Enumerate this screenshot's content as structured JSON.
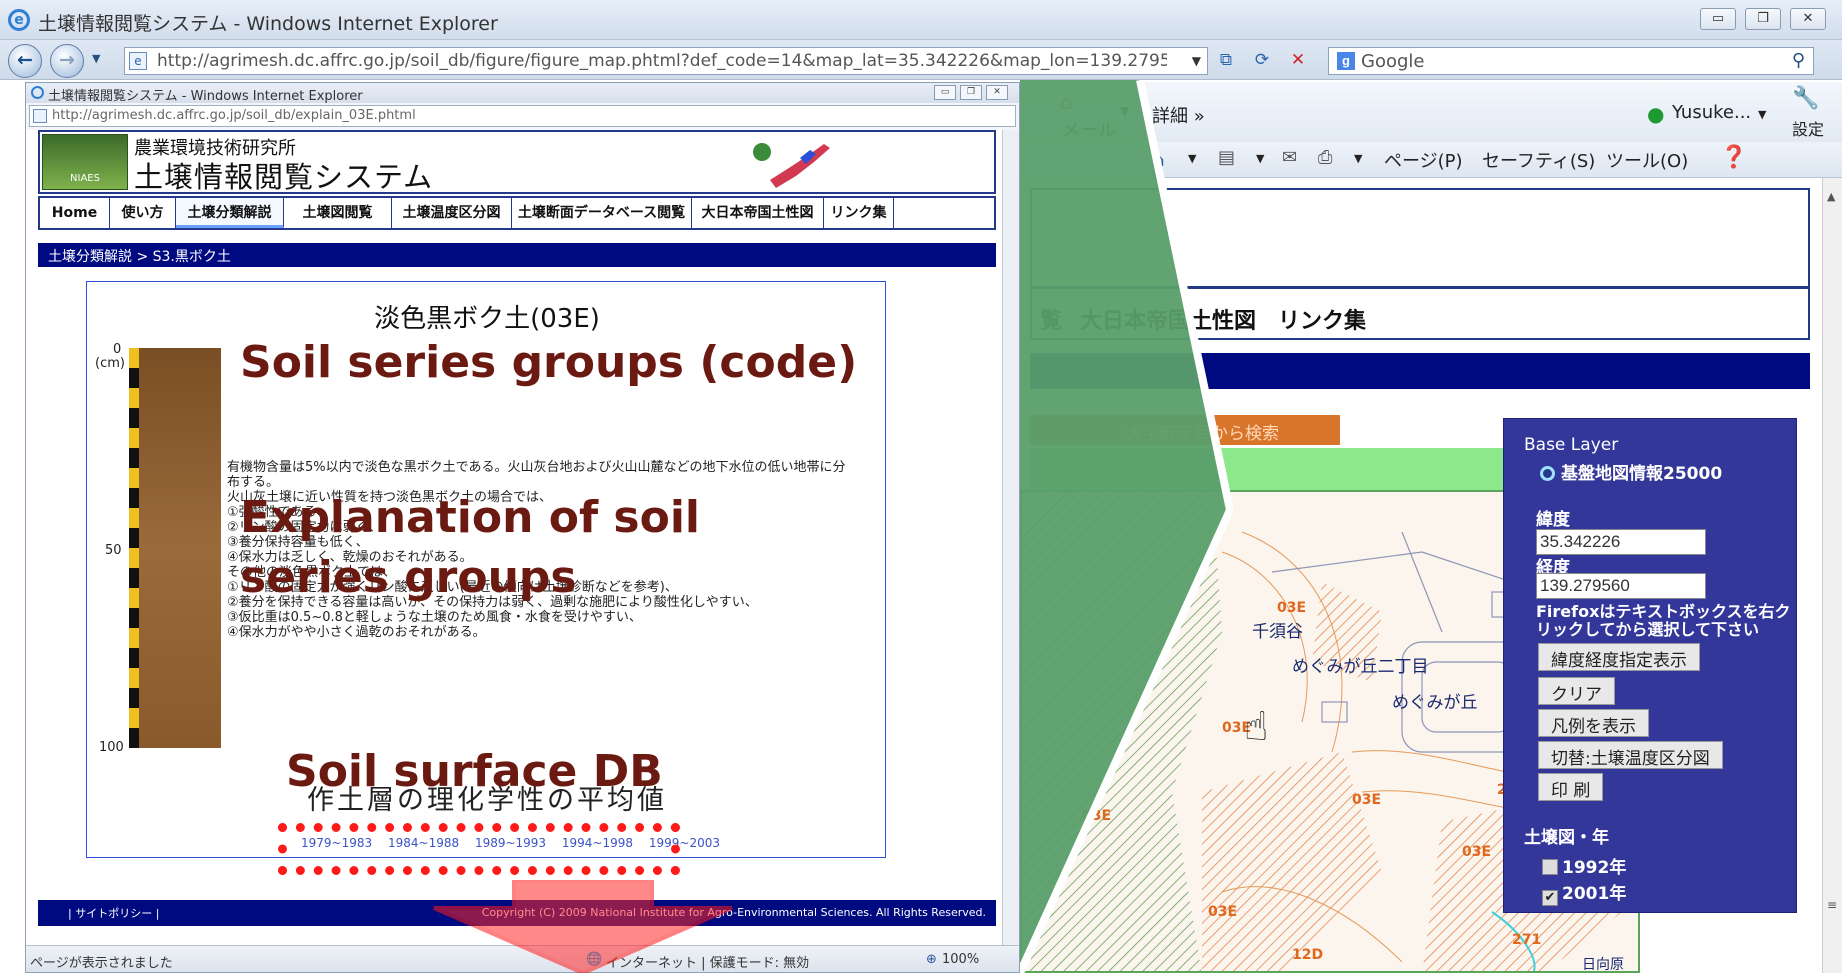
{
  "outer_window": {
    "title": "土壌情報閲覧システム - Windows Internet Explorer",
    "address": "http://agrimesh.dc.affrc.go.jp/soil_db/figure/figure_map.phtml?def_code=14&map_lat=35.342226&map_lon=139.2795€",
    "search_engine": "Google",
    "minimize_glyph": "▭",
    "restore_glyph": "❐",
    "close_glyph": "✕"
  },
  "outer_commands": {
    "mail": "メール",
    "detail": "詳細 »",
    "user": "Yusuke...",
    "settings": "設定",
    "page": "ページ(P)",
    "safety": "セーフティ(S)",
    "tools": "ツール(O)"
  },
  "outer_page": {
    "nav_partial": "覧",
    "nav_imperial": "大日本帝国土性図",
    "nav_links": "リンク集",
    "orange_tab": "大字町丁目から検索",
    "map_labels": [
      "千須谷",
      "めぐみが丘二丁目",
      "めぐみが丘"
    ],
    "map_codes": [
      "03E",
      "03E",
      "03E",
      "03E",
      "03E",
      "03E",
      "12D",
      "271",
      "271"
    ],
    "map_bottom_label": "日向原"
  },
  "base_layer": {
    "title": "Base Layer",
    "radio_label": "基盤地図情報25000",
    "lat_label": "緯度",
    "lat_value": "35.342226",
    "lon_label": "経度",
    "lon_value": "139.279560",
    "firefox_note": "Firefoxはテキストボックスを右クリックしてから選択して下さい",
    "btn_show": "緯度経度指定表示",
    "btn_clear": "クリア",
    "btn_legend": "凡例を表示",
    "btn_switch": "切替:土壌温度区分図",
    "btn_print": "印 刷",
    "year_title": "土壌図・年",
    "year_1992": "1992年",
    "year_2001": "2001年"
  },
  "inner_window": {
    "title": "土壌情報閲覧システム - Windows Internet Explorer",
    "address": "http://agrimesh.dc.affrc.go.jp/soil_db/explain_03E.phtml",
    "status_left": "ページが表示されました",
    "status_zone": "インターネット | 保護モード: 無効",
    "zoom": "100%"
  },
  "site": {
    "org": "農業環境技術研究所",
    "system": "土壌情報閲覧システム",
    "logo_text": "NIAES",
    "nav": [
      "Home",
      "使い方",
      "土壌分類解説",
      "土壌図閲覧",
      "土壌温度区分図",
      "土壌断面データベース閲覧",
      "大日本帝国土性図",
      "リンク集"
    ],
    "active_nav_index": 2,
    "breadcrumb": "土壌分類解説 > S3.黒ボク土",
    "footer_policy": "| サイトポリシー |",
    "footer_copy": "Copyright (C) 2009 National Institute for Agro-Environmental Sciences. All Rights Reserved."
  },
  "article": {
    "title": "淡色黒ボク土(03E)",
    "axis": {
      "top": "0",
      "unit": "(cm)",
      "mid": "50",
      "bottom": "100"
    },
    "lines": [
      "有機物含量は5%以内で淡色な黒ボク土である。火山灰台地および火山山麓などの地下水位の低い地帯に分",
      "布する。",
      "火山灰土壌に近い性質を持つ淡色黒ボク土の場合では、",
      "①強酸性である、",
      "②リン酸の固定力は弱く、",
      "③養分保持容量も低く、",
      "④保水力は乏しく、乾燥のおそれがある。",
      "その他の淡色黒ボク土では、",
      "①リン酸の固定力が強くリン酸に乏しい(最近の傾向は土壌診断などを参考)、",
      "②養分を保持できる容量は高いが、その保持力は弱く、過剰な施肥により酸性化しやすい、",
      "③仮比重は0.5~0.8と軽しょうな土壌のため風食・水食を受けやすい、",
      "④保水力がやや小さく過乾のおそれがある。"
    ],
    "db_heading": "作土層の理化学性の平均値",
    "db_links": [
      "1979~1983",
      "1984~1988",
      "1989~1993",
      "1994~1998",
      "1999~2003"
    ]
  },
  "annotations": {
    "soil_series": "Soil series groups (code)",
    "explanation_line1": "Explanation of soil",
    "explanation_line2": "series groups",
    "soil_surface": "Soil surface DB"
  },
  "colors": {
    "site_blue": "#000a80",
    "annotation": "#6b1a12",
    "highlight_red": "#ff1a1a",
    "panel_purple": "#333799"
  }
}
